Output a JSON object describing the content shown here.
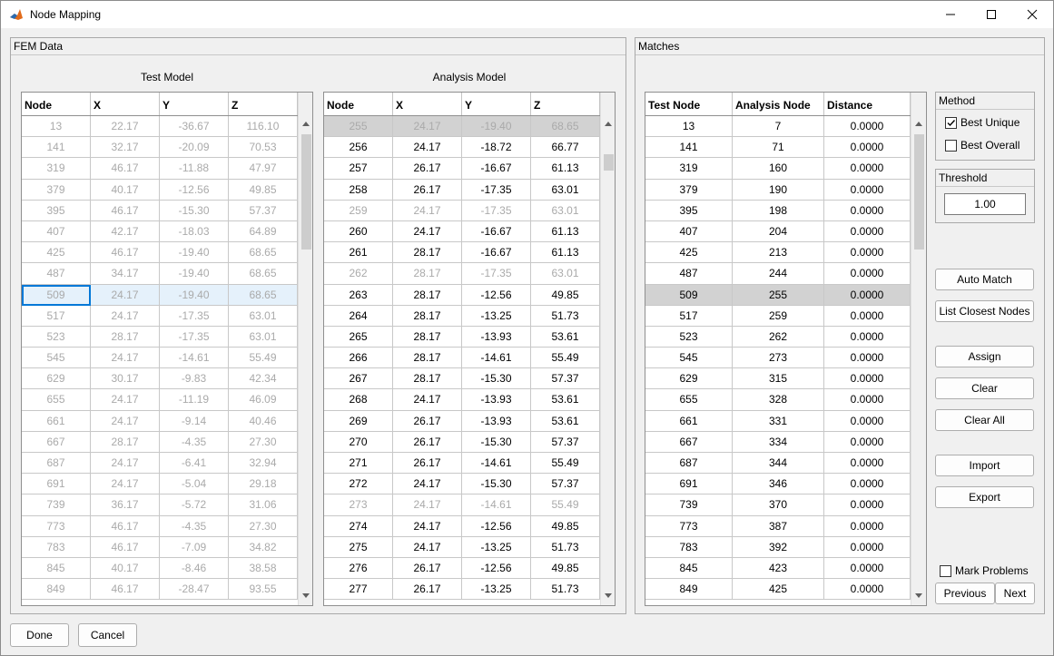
{
  "window": {
    "title": "Node Mapping"
  },
  "fem_panel": {
    "title": "FEM Data",
    "test_label": "Test Model",
    "analysis_label": "Analysis Model"
  },
  "matches_panel": {
    "title": "Matches"
  },
  "test_table": {
    "headers": [
      "Node",
      "X",
      "Y",
      "Z"
    ],
    "rows": [
      [
        "13",
        "22.17",
        "-36.67",
        "116.10"
      ],
      [
        "141",
        "32.17",
        "-20.09",
        "70.53"
      ],
      [
        "319",
        "46.17",
        "-11.88",
        "47.97"
      ],
      [
        "379",
        "40.17",
        "-12.56",
        "49.85"
      ],
      [
        "395",
        "46.17",
        "-15.30",
        "57.37"
      ],
      [
        "407",
        "42.17",
        "-18.03",
        "64.89"
      ],
      [
        "425",
        "46.17",
        "-19.40",
        "68.65"
      ],
      [
        "487",
        "34.17",
        "-19.40",
        "68.65"
      ],
      [
        "509",
        "24.17",
        "-19.40",
        "68.65"
      ],
      [
        "517",
        "24.17",
        "-17.35",
        "63.01"
      ],
      [
        "523",
        "28.17",
        "-17.35",
        "63.01"
      ],
      [
        "545",
        "24.17",
        "-14.61",
        "55.49"
      ],
      [
        "629",
        "30.17",
        "-9.83",
        "42.34"
      ],
      [
        "655",
        "24.17",
        "-11.19",
        "46.09"
      ],
      [
        "661",
        "24.17",
        "-9.14",
        "40.46"
      ],
      [
        "667",
        "28.17",
        "-4.35",
        "27.30"
      ],
      [
        "687",
        "24.17",
        "-6.41",
        "32.94"
      ],
      [
        "691",
        "24.17",
        "-5.04",
        "29.18"
      ],
      [
        "739",
        "36.17",
        "-5.72",
        "31.06"
      ],
      [
        "773",
        "46.17",
        "-4.35",
        "27.30"
      ],
      [
        "783",
        "46.17",
        "-7.09",
        "34.82"
      ],
      [
        "845",
        "40.17",
        "-8.46",
        "38.58"
      ],
      [
        "849",
        "46.17",
        "-28.47",
        "93.55"
      ]
    ]
  },
  "analysis_table": {
    "headers": [
      "Node",
      "X",
      "Y",
      "Z"
    ],
    "rows": [
      [
        "255",
        "24.17",
        "-19.40",
        "68.65"
      ],
      [
        "256",
        "24.17",
        "-18.72",
        "66.77"
      ],
      [
        "257",
        "26.17",
        "-16.67",
        "61.13"
      ],
      [
        "258",
        "26.17",
        "-17.35",
        "63.01"
      ],
      [
        "259",
        "24.17",
        "-17.35",
        "63.01"
      ],
      [
        "260",
        "24.17",
        "-16.67",
        "61.13"
      ],
      [
        "261",
        "28.17",
        "-16.67",
        "61.13"
      ],
      [
        "262",
        "28.17",
        "-17.35",
        "63.01"
      ],
      [
        "263",
        "28.17",
        "-12.56",
        "49.85"
      ],
      [
        "264",
        "28.17",
        "-13.25",
        "51.73"
      ],
      [
        "265",
        "28.17",
        "-13.93",
        "53.61"
      ],
      [
        "266",
        "28.17",
        "-14.61",
        "55.49"
      ],
      [
        "267",
        "28.17",
        "-15.30",
        "57.37"
      ],
      [
        "268",
        "24.17",
        "-13.93",
        "53.61"
      ],
      [
        "269",
        "26.17",
        "-13.93",
        "53.61"
      ],
      [
        "270",
        "26.17",
        "-15.30",
        "57.37"
      ],
      [
        "271",
        "26.17",
        "-14.61",
        "55.49"
      ],
      [
        "272",
        "24.17",
        "-15.30",
        "57.37"
      ],
      [
        "273",
        "24.17",
        "-14.61",
        "55.49"
      ],
      [
        "274",
        "24.17",
        "-12.56",
        "49.85"
      ],
      [
        "275",
        "24.17",
        "-13.25",
        "51.73"
      ],
      [
        "276",
        "26.17",
        "-12.56",
        "49.85"
      ],
      [
        "277",
        "26.17",
        "-13.25",
        "51.73"
      ]
    ],
    "dimmed_rows": [
      0,
      4,
      7,
      18
    ]
  },
  "matches_table": {
    "headers": [
      "Test Node",
      "Analysis Node",
      "Distance"
    ],
    "rows": [
      [
        "13",
        "7",
        "0.0000"
      ],
      [
        "141",
        "71",
        "0.0000"
      ],
      [
        "319",
        "160",
        "0.0000"
      ],
      [
        "379",
        "190",
        "0.0000"
      ],
      [
        "395",
        "198",
        "0.0000"
      ],
      [
        "407",
        "204",
        "0.0000"
      ],
      [
        "425",
        "213",
        "0.0000"
      ],
      [
        "487",
        "244",
        "0.0000"
      ],
      [
        "509",
        "255",
        "0.0000"
      ],
      [
        "517",
        "259",
        "0.0000"
      ],
      [
        "523",
        "262",
        "0.0000"
      ],
      [
        "545",
        "273",
        "0.0000"
      ],
      [
        "629",
        "315",
        "0.0000"
      ],
      [
        "655",
        "328",
        "0.0000"
      ],
      [
        "661",
        "331",
        "0.0000"
      ],
      [
        "667",
        "334",
        "0.0000"
      ],
      [
        "687",
        "344",
        "0.0000"
      ],
      [
        "691",
        "346",
        "0.0000"
      ],
      [
        "739",
        "370",
        "0.0000"
      ],
      [
        "773",
        "387",
        "0.0000"
      ],
      [
        "783",
        "392",
        "0.0000"
      ],
      [
        "845",
        "423",
        "0.0000"
      ],
      [
        "849",
        "425",
        "0.0000"
      ]
    ],
    "selected_row": 8
  },
  "method": {
    "title": "Method",
    "best_unique": "Best Unique",
    "best_unique_checked": true,
    "best_overall": "Best Overall",
    "best_overall_checked": false
  },
  "threshold": {
    "title": "Threshold",
    "value": "1.00"
  },
  "buttons": {
    "auto_match": "Auto Match",
    "list_closest": "List Closest Nodes",
    "assign": "Assign",
    "clear": "Clear",
    "clear_all": "Clear All",
    "import": "Import",
    "export": "Export",
    "previous": "Previous",
    "next": "Next",
    "done": "Done",
    "cancel": "Cancel"
  },
  "mark_problems": {
    "label": "Mark Problems",
    "checked": false
  },
  "colors": {
    "selection": "#e5f1fb",
    "selection_border": "#0078d7",
    "match_highlight": "#d2d2d2",
    "dimmed_text": "#aaaaaa"
  }
}
